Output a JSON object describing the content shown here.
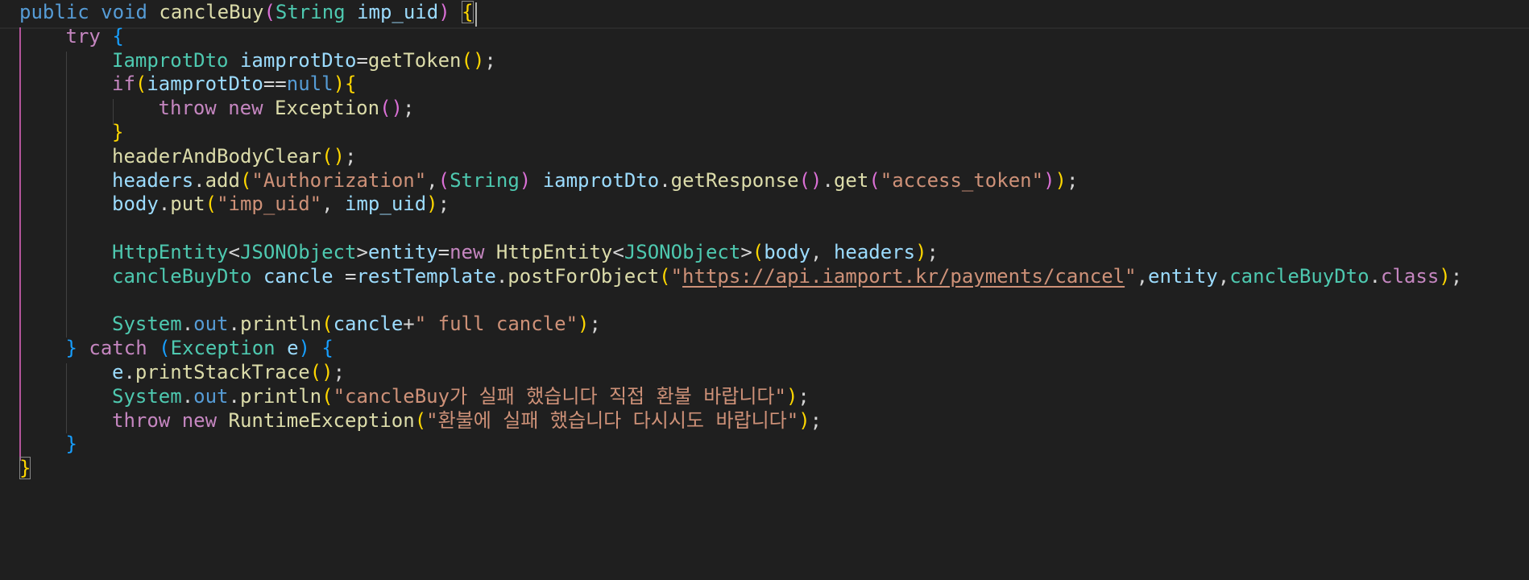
{
  "editor": {
    "colors": {
      "background": "#1f1f1f",
      "keyword": "#569cd6",
      "control": "#c586c0",
      "type": "#4ec9b0",
      "variable": "#9cdcfe",
      "function": "#dcdcaa",
      "string": "#ce9178",
      "bracket_level1": "#ffd700",
      "bracket_level2": "#da70d6",
      "bracket_level3": "#179fff",
      "active_indent_guide": "#b4559c"
    },
    "lines": [
      {
        "indent": 0,
        "tokens": [
          {
            "t": "public",
            "c": "kw"
          },
          {
            "t": " ",
            "c": "plain"
          },
          {
            "t": "void",
            "c": "kw"
          },
          {
            "t": " ",
            "c": "plain"
          },
          {
            "t": "cancleBuy",
            "c": "fn"
          },
          {
            "t": "(",
            "c": "p2"
          },
          {
            "t": "String",
            "c": "type"
          },
          {
            "t": " ",
            "c": "plain"
          },
          {
            "t": "imp_uid",
            "c": "var"
          },
          {
            "t": ")",
            "c": "p2"
          },
          {
            "t": " ",
            "c": "plain"
          },
          {
            "t": "{",
            "c": "p1",
            "match": true
          }
        ]
      },
      {
        "indent": 1,
        "tokens": [
          {
            "t": "try",
            "c": "ctrl"
          },
          {
            "t": " ",
            "c": "plain"
          },
          {
            "t": "{",
            "c": "p3"
          }
        ]
      },
      {
        "indent": 2,
        "tokens": [
          {
            "t": "IamprotDto",
            "c": "type"
          },
          {
            "t": " ",
            "c": "plain"
          },
          {
            "t": "iamprotDto",
            "c": "var"
          },
          {
            "t": "=",
            "c": "op"
          },
          {
            "t": "getToken",
            "c": "fn"
          },
          {
            "t": "()",
            "c": "p1"
          },
          {
            "t": ";",
            "c": "plain"
          }
        ]
      },
      {
        "indent": 2,
        "tokens": [
          {
            "t": "if",
            "c": "ctrl"
          },
          {
            "t": "(",
            "c": "p1"
          },
          {
            "t": "iamprotDto",
            "c": "var"
          },
          {
            "t": "==",
            "c": "op"
          },
          {
            "t": "null",
            "c": "kw"
          },
          {
            "t": ")",
            "c": "p1"
          },
          {
            "t": "{",
            "c": "p1"
          }
        ]
      },
      {
        "indent": 3,
        "tokens": [
          {
            "t": "throw",
            "c": "ctrl"
          },
          {
            "t": " ",
            "c": "plain"
          },
          {
            "t": "new",
            "c": "ctrl"
          },
          {
            "t": " ",
            "c": "plain"
          },
          {
            "t": "Exception",
            "c": "fn"
          },
          {
            "t": "()",
            "c": "p2"
          },
          {
            "t": ";",
            "c": "plain"
          }
        ]
      },
      {
        "indent": 2,
        "tokens": [
          {
            "t": "}",
            "c": "p1"
          }
        ]
      },
      {
        "indent": 2,
        "tokens": [
          {
            "t": "headerAndBodyClear",
            "c": "fn"
          },
          {
            "t": "()",
            "c": "p1"
          },
          {
            "t": ";",
            "c": "plain"
          }
        ]
      },
      {
        "indent": 2,
        "tokens": [
          {
            "t": "headers",
            "c": "var"
          },
          {
            "t": ".",
            "c": "plain"
          },
          {
            "t": "add",
            "c": "fn"
          },
          {
            "t": "(",
            "c": "p1"
          },
          {
            "t": "\"Authorization\"",
            "c": "str"
          },
          {
            "t": ",",
            "c": "plain"
          },
          {
            "t": "(",
            "c": "p2"
          },
          {
            "t": "String",
            "c": "type"
          },
          {
            "t": ")",
            "c": "p2"
          },
          {
            "t": " ",
            "c": "plain"
          },
          {
            "t": "iamprotDto",
            "c": "var"
          },
          {
            "t": ".",
            "c": "plain"
          },
          {
            "t": "getResponse",
            "c": "fn"
          },
          {
            "t": "()",
            "c": "p2"
          },
          {
            "t": ".",
            "c": "plain"
          },
          {
            "t": "get",
            "c": "fn"
          },
          {
            "t": "(",
            "c": "p2"
          },
          {
            "t": "\"access_token\"",
            "c": "str"
          },
          {
            "t": ")",
            "c": "p2"
          },
          {
            "t": ")",
            "c": "p1"
          },
          {
            "t": ";",
            "c": "plain"
          }
        ]
      },
      {
        "indent": 2,
        "tokens": [
          {
            "t": "body",
            "c": "var"
          },
          {
            "t": ".",
            "c": "plain"
          },
          {
            "t": "put",
            "c": "fn"
          },
          {
            "t": "(",
            "c": "p1"
          },
          {
            "t": "\"imp_uid\"",
            "c": "str"
          },
          {
            "t": ", ",
            "c": "plain"
          },
          {
            "t": "imp_uid",
            "c": "var"
          },
          {
            "t": ")",
            "c": "p1"
          },
          {
            "t": ";",
            "c": "plain"
          }
        ]
      },
      {
        "indent": 2,
        "tokens": []
      },
      {
        "indent": 2,
        "tokens": [
          {
            "t": "HttpEntity",
            "c": "type"
          },
          {
            "t": "<",
            "c": "op"
          },
          {
            "t": "JSONObject",
            "c": "type"
          },
          {
            "t": ">",
            "c": "op"
          },
          {
            "t": "entity",
            "c": "var"
          },
          {
            "t": "=",
            "c": "op"
          },
          {
            "t": "new",
            "c": "ctrl"
          },
          {
            "t": " ",
            "c": "plain"
          },
          {
            "t": "HttpEntity",
            "c": "fn"
          },
          {
            "t": "<",
            "c": "op"
          },
          {
            "t": "JSONObject",
            "c": "type"
          },
          {
            "t": ">",
            "c": "op"
          },
          {
            "t": "(",
            "c": "p1"
          },
          {
            "t": "body",
            "c": "var"
          },
          {
            "t": ", ",
            "c": "plain"
          },
          {
            "t": "headers",
            "c": "var"
          },
          {
            "t": ")",
            "c": "p1"
          },
          {
            "t": ";",
            "c": "plain"
          }
        ]
      },
      {
        "indent": 2,
        "tokens": [
          {
            "t": "cancleBuyDto",
            "c": "type"
          },
          {
            "t": " ",
            "c": "plain"
          },
          {
            "t": "cancle",
            "c": "var"
          },
          {
            "t": " ",
            "c": "plain"
          },
          {
            "t": "=",
            "c": "op"
          },
          {
            "t": "restTemplate",
            "c": "var"
          },
          {
            "t": ".",
            "c": "plain"
          },
          {
            "t": "postForObject",
            "c": "fn"
          },
          {
            "t": "(",
            "c": "p1"
          },
          {
            "t": "\"",
            "c": "str"
          },
          {
            "t": "https://api.iamport.kr/payments/cancel",
            "c": "url"
          },
          {
            "t": "\"",
            "c": "str"
          },
          {
            "t": ",",
            "c": "plain"
          },
          {
            "t": "entity",
            "c": "var"
          },
          {
            "t": ",",
            "c": "plain"
          },
          {
            "t": "cancleBuyDto",
            "c": "type"
          },
          {
            "t": ".",
            "c": "plain"
          },
          {
            "t": "class",
            "c": "ctrl"
          },
          {
            "t": ")",
            "c": "p1"
          },
          {
            "t": ";",
            "c": "plain"
          }
        ]
      },
      {
        "indent": 2,
        "tokens": []
      },
      {
        "indent": 2,
        "tokens": [
          {
            "t": "System",
            "c": "type"
          },
          {
            "t": ".",
            "c": "plain"
          },
          {
            "t": "out",
            "c": "kw"
          },
          {
            "t": ".",
            "c": "plain"
          },
          {
            "t": "println",
            "c": "fn"
          },
          {
            "t": "(",
            "c": "p1"
          },
          {
            "t": "cancle",
            "c": "var"
          },
          {
            "t": "+",
            "c": "op"
          },
          {
            "t": "\" full cancle\"",
            "c": "str"
          },
          {
            "t": ")",
            "c": "p1"
          },
          {
            "t": ";",
            "c": "plain"
          }
        ]
      },
      {
        "indent": 1,
        "tokens": [
          {
            "t": "}",
            "c": "p3"
          },
          {
            "t": " ",
            "c": "plain"
          },
          {
            "t": "catch",
            "c": "ctrl"
          },
          {
            "t": " ",
            "c": "plain"
          },
          {
            "t": "(",
            "c": "p3"
          },
          {
            "t": "Exception",
            "c": "type"
          },
          {
            "t": " ",
            "c": "plain"
          },
          {
            "t": "e",
            "c": "var"
          },
          {
            "t": ")",
            "c": "p3"
          },
          {
            "t": " ",
            "c": "plain"
          },
          {
            "t": "{",
            "c": "p3"
          }
        ]
      },
      {
        "indent": 2,
        "tokens": [
          {
            "t": "e",
            "c": "var"
          },
          {
            "t": ".",
            "c": "plain"
          },
          {
            "t": "printStackTrace",
            "c": "fn"
          },
          {
            "t": "()",
            "c": "p1"
          },
          {
            "t": ";",
            "c": "plain"
          }
        ]
      },
      {
        "indent": 2,
        "tokens": [
          {
            "t": "System",
            "c": "type"
          },
          {
            "t": ".",
            "c": "plain"
          },
          {
            "t": "out",
            "c": "kw"
          },
          {
            "t": ".",
            "c": "plain"
          },
          {
            "t": "println",
            "c": "fn"
          },
          {
            "t": "(",
            "c": "p1"
          },
          {
            "t": "\"cancleBuy가 실패 했습니다 직접 환불 바랍니다\"",
            "c": "str"
          },
          {
            "t": ")",
            "c": "p1"
          },
          {
            "t": ";",
            "c": "plain"
          }
        ]
      },
      {
        "indent": 2,
        "tokens": [
          {
            "t": "throw",
            "c": "ctrl"
          },
          {
            "t": " ",
            "c": "plain"
          },
          {
            "t": "new",
            "c": "ctrl"
          },
          {
            "t": " ",
            "c": "plain"
          },
          {
            "t": "RuntimeException",
            "c": "fn"
          },
          {
            "t": "(",
            "c": "p1"
          },
          {
            "t": "\"환불에 실패 했습니다 다시시도 바랍니다\"",
            "c": "str"
          },
          {
            "t": ")",
            "c": "p1"
          },
          {
            "t": ";",
            "c": "plain"
          }
        ]
      },
      {
        "indent": 1,
        "tokens": [
          {
            "t": "}",
            "c": "p3"
          }
        ]
      },
      {
        "indent": 0,
        "tokens": [
          {
            "t": "}",
            "c": "p1",
            "match": true
          }
        ]
      }
    ]
  }
}
